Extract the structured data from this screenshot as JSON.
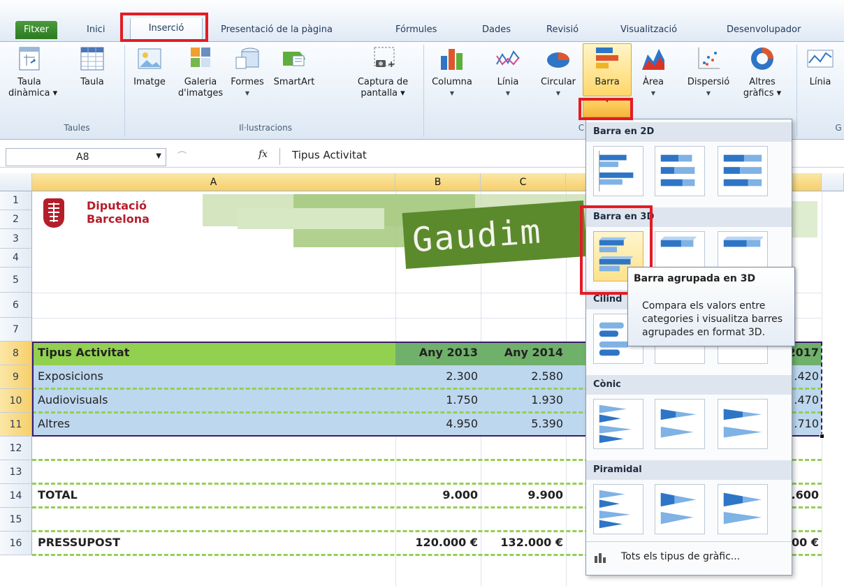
{
  "ribbon": {
    "tabs": [
      "Fitxer",
      "Inici",
      "Inserció",
      "Presentació de la pàgina",
      "Fórmules",
      "Dades",
      "Revisió",
      "Visualització",
      "Desenvolupador"
    ],
    "buttons": {
      "taula_dinamica": [
        "Taula",
        "dinàmica ▾"
      ],
      "taula": "Taula",
      "imatge": "Imatge",
      "galeria": [
        "Galeria",
        "d'imatges"
      ],
      "formes": "Formes",
      "smartart": "SmartArt",
      "captura": [
        "Captura de",
        "pantalla ▾"
      ],
      "columna": "Columna",
      "linia": "Línia",
      "circular": "Circular",
      "barra": "Barra",
      "area": "Àrea",
      "dispersio": "Dispersió",
      "altres": [
        "Altres",
        "gràfics ▾"
      ],
      "linia2": "Línia"
    },
    "groups": {
      "taules": "Taules",
      "illustracions": "Il·lustracions",
      "g_fragment": "G",
      "c_fragment": "C"
    }
  },
  "formula_bar": {
    "name_box": "A8",
    "fx": "fx",
    "content": "Tipus Activitat"
  },
  "sheet": {
    "columns": [
      "A",
      "B",
      "C"
    ],
    "rows": [
      "1",
      "2",
      "3",
      "4",
      "5",
      "6",
      "7",
      "8",
      "9",
      "10",
      "11",
      "12",
      "13",
      "14",
      "15",
      "16"
    ],
    "logo": [
      "Diputació",
      "Barcelona"
    ],
    "banner": "Gaudim",
    "header": {
      "label": "Tipus Activitat",
      "y2013": "Any 2013",
      "y2014": "Any 2014",
      "y2017": "2017"
    },
    "data": [
      {
        "label": "Exposicions",
        "v2013": "2.300",
        "v2014": "2.580",
        "v2017": ".420"
      },
      {
        "label": "Audiovisuals",
        "v2013": "1.750",
        "v2014": "1.930",
        "v2017": ".470"
      },
      {
        "label": "Altres",
        "v2013": "4.950",
        "v2014": "5.390",
        "v2017": ".710"
      }
    ],
    "total": {
      "label": "TOTAL",
      "v2013": "9.000",
      "v2014": "9.900",
      "v2017": ".600"
    },
    "budget": {
      "label": "PRESSUPOST",
      "v2013": "120.000 €",
      "v2014": "132.000 €",
      "v2017": "00 €"
    }
  },
  "dropdown": {
    "sections": [
      "Barra en 2D",
      "Barra en 3D",
      "Cilind",
      "Cònic",
      "Piramidal"
    ],
    "all_types": "Tots els tipus de gràfic..."
  },
  "tooltip": {
    "title": "Barra agrupada en 3D",
    "body": [
      "Compara els valors entre",
      "categories i visualitza barres",
      "agrupades en format 3D."
    ]
  },
  "colors": {
    "accent_red": "#e31c24",
    "header_green": "#92d050",
    "row_blue": "#bdd7ee",
    "brand_red": "#b41e2a"
  }
}
